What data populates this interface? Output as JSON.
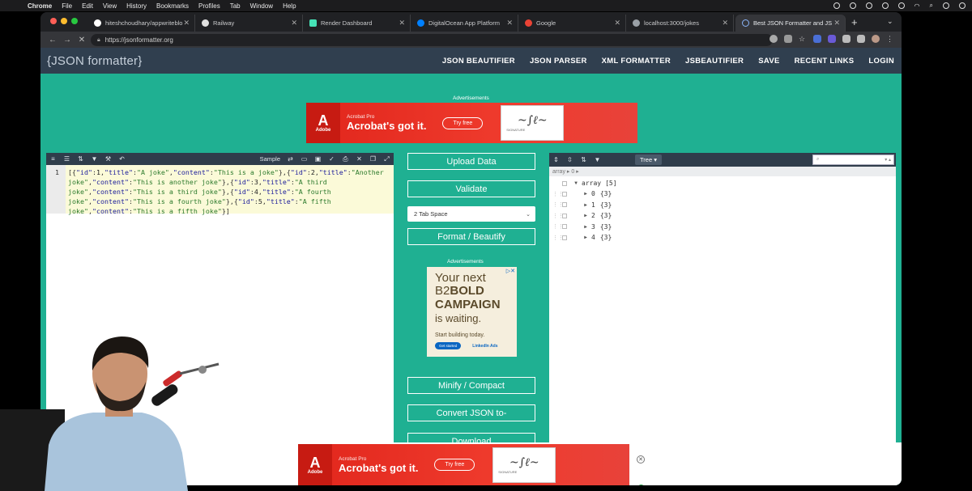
{
  "macos_menubar": {
    "app": "Chrome",
    "items": [
      "File",
      "Edit",
      "View",
      "History",
      "Bookmarks",
      "Profiles",
      "Tab",
      "Window",
      "Help"
    ]
  },
  "browser": {
    "tabs": [
      {
        "title": "hiteshchoudhary/appwriteblo",
        "favicon_color": "#ffffff"
      },
      {
        "title": "Railway",
        "favicon_color": "#e0e0e0"
      },
      {
        "title": "Render Dashboard",
        "favicon_color": "#46e3b7"
      },
      {
        "title": "DigitalOcean App Platform",
        "favicon_color": "#0080ff"
      },
      {
        "title": "Google",
        "favicon_color": "#ea4335"
      },
      {
        "title": "localhost:3000/jokes",
        "favicon_color": "#9aa0a6"
      },
      {
        "title": "Best JSON Formatter and JS",
        "favicon_color": "#8ab4f8"
      }
    ],
    "url": "https://jsonformatter.org"
  },
  "site": {
    "logo": "{JSON formatter}",
    "nav": [
      "JSON BEAUTIFIER",
      "JSON PARSER",
      "XML FORMATTER",
      "JSBEAUTIFIER",
      "SAVE",
      "RECENT LINKS",
      "LOGIN"
    ],
    "ad_label": "Advertisements",
    "ad_label_mid": "Advertisements"
  },
  "adobe_ad": {
    "brand": "Adobe",
    "small": "Acrobat Pro",
    "big": "Acrobat's got it.",
    "cta": "Try free",
    "signature_label": "SIGNATURE"
  },
  "editor": {
    "sample_label": "Sample",
    "line_number": "1",
    "json_text": "[{\"id\":1,\"title\":\"A joke\",\"content\":\"This is a joke\"},{\"id\":2,\"title\":\"Another joke\",\"content\":\"This is another joke\"},{\"id\":3,\"title\":\"A third joke\",\"content\":\"This is a third joke\"},{\"id\":4,\"title\":\"A fourth joke\",\"content\":\"This is a fourth joke\"},{\"id\":5,\"title\":\"A fifth joke\",\"content\":\"This is a fifth joke\"}]"
  },
  "actions": {
    "upload": "Upload Data",
    "validate": "Validate",
    "indent_option": "2 Tab Space",
    "format": "Format / Beautify",
    "minify": "Minify / Compact",
    "convert": "Convert JSON to-",
    "download": "Download"
  },
  "linkedin_ad": {
    "line1": "Your next",
    "line2_a": "B2",
    "line2_b": "BOLD",
    "line3": "CAMPAIGN",
    "line4": "is waiting.",
    "line5": "Start building today.",
    "cta": "Get started",
    "brand": "LinkedIn Ads"
  },
  "treeview": {
    "mode": "Tree",
    "breadcrumb": "array ▸ 0 ▸",
    "root_label": "array",
    "root_count": "[5]",
    "items": [
      {
        "index": "0",
        "summary": "{3}"
      },
      {
        "index": "1",
        "summary": "{3}"
      },
      {
        "index": "2",
        "summary": "{3}"
      },
      {
        "index": "3",
        "summary": "{3}"
      },
      {
        "index": "4",
        "summary": "{3}"
      }
    ]
  }
}
